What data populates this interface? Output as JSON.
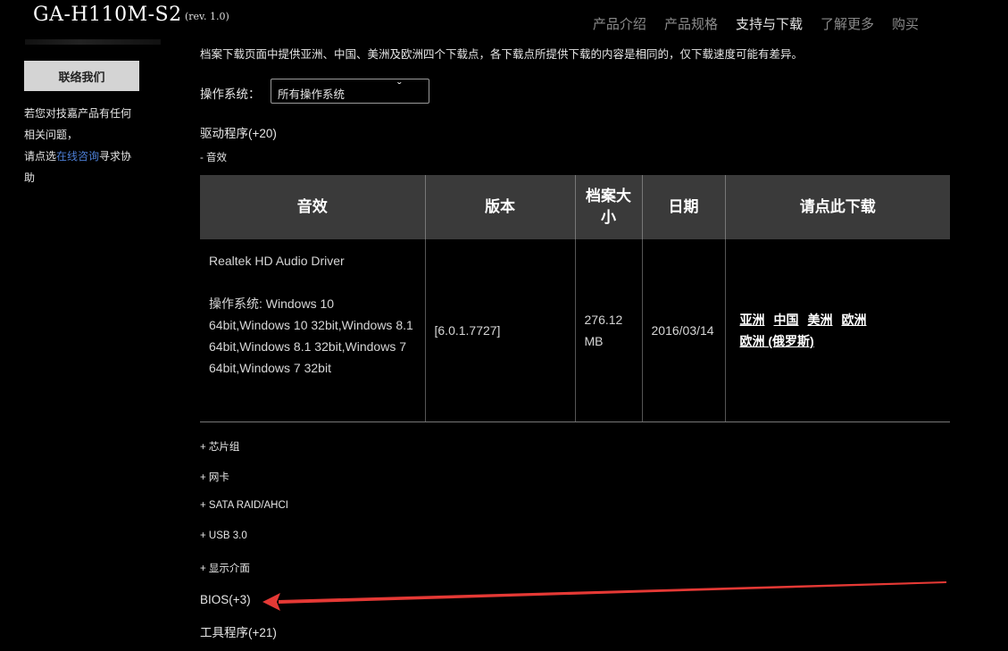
{
  "header": {
    "model": "GA-H110M-S2",
    "revision": "(rev. 1.0)",
    "nav": [
      {
        "label": "产品介绍",
        "active": false
      },
      {
        "label": "产品规格",
        "active": false
      },
      {
        "label": "支持与下载",
        "active": true
      },
      {
        "label": "了解更多",
        "active": false
      },
      {
        "label": "购买",
        "active": false
      }
    ]
  },
  "sidebar": {
    "contact_button": "联络我们",
    "text_before": "若您对技嘉产品有任何相关问题，",
    "text_line2": "请点选",
    "link": "在线咨询",
    "text_after": "寻求协助"
  },
  "main": {
    "intro": "档案下载页面中提供亚洲、中国、美洲及欧洲四个下载点，各下载点所提供下载的内容是相同的，仅下载速度可能有差异。",
    "os_label": "操作系统：",
    "os_select": "所有操作系统",
    "drivers_title": "驱动程序(+20)",
    "audio_sub": "- 音效",
    "table": {
      "headers": [
        "音效",
        "版本",
        "档案大小",
        "日期",
        "请点此下载"
      ],
      "row": {
        "name": "Realtek HD Audio Driver",
        "os_prefix": "操作系统:",
        "os_list": "Windows 10 64bit,Windows 10 32bit,Windows 8.1 64bit,Windows 8.1 32bit,Windows 7 64bit,Windows 7 32bit",
        "version": "[6.0.1.7727]",
        "size": "276.12 MB",
        "date": "2016/03/14",
        "links": [
          "亚洲",
          "中国",
          "美洲",
          "欧洲",
          "欧洲 (俄罗斯)"
        ]
      }
    },
    "sub_categories": [
      "+ 芯片组",
      "+ 网卡",
      "+ SATA RAID/AHCI",
      "+ USB 3.0",
      "+ 显示介面"
    ],
    "bios_title": "BIOS(+3)",
    "tools_title": "工具程序(+21)"
  },
  "colors": {
    "background": "#000000",
    "table_header": "#3a3a3a",
    "link_blue": "#4d7fd6",
    "annotation_arrow": "#e53935"
  }
}
